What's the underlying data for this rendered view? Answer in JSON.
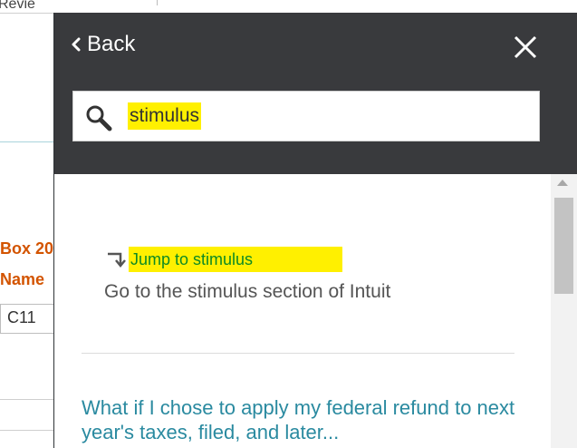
{
  "background": {
    "top_text": "Revie",
    "box_label": "Box 20",
    "name_label": "Name",
    "cell_value": "C11"
  },
  "panel": {
    "back_label": "Back",
    "search": {
      "value": "stimulus"
    },
    "result": {
      "jump_label": "Jump to stimulus",
      "description": "Go to the stimulus section of Intuit"
    },
    "faq_link": "What if I chose to apply my federal refund to next year's taxes, filed, and later..."
  },
  "colors": {
    "header": "#393a3d",
    "highlight": "#fff000",
    "jump_text": "#0c8a24",
    "link": "#2a8aa0",
    "background_label": "#d35400"
  },
  "icons": [
    "chevron-left-icon",
    "close-icon",
    "search-icon",
    "jump-arrow-icon"
  ]
}
